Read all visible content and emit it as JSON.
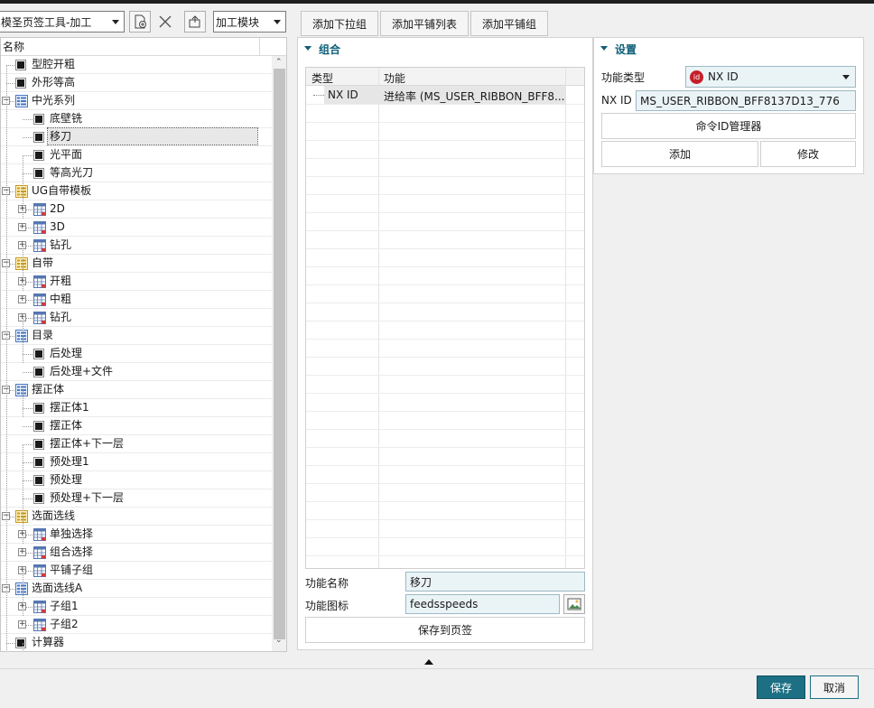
{
  "toolbar": {
    "tool_select": "模圣页签工具-加工",
    "module_select": "加工模块"
  },
  "tree": {
    "header": "名称",
    "rows": [
      {
        "label": "型腔开粗",
        "level": 0,
        "type": "item"
      },
      {
        "label": "外形等高",
        "level": 0,
        "type": "item"
      },
      {
        "label": "中光系列",
        "level": 0,
        "type": "list"
      },
      {
        "label": "底壁铣",
        "level": 1,
        "type": "item"
      },
      {
        "label": "移刀",
        "level": 1,
        "type": "item",
        "selected": true
      },
      {
        "label": "光平面",
        "level": 1,
        "type": "item"
      },
      {
        "label": "等高光刀",
        "level": 1,
        "type": "item"
      },
      {
        "label": "UG自带模板",
        "level": 0,
        "type": "group"
      },
      {
        "label": "2D",
        "level": 1,
        "type": "table"
      },
      {
        "label": "3D",
        "level": 1,
        "type": "table"
      },
      {
        "label": "钻孔",
        "level": 1,
        "type": "table"
      },
      {
        "label": "自带",
        "level": 0,
        "type": "group"
      },
      {
        "label": "开粗",
        "level": 1,
        "type": "table"
      },
      {
        "label": "中粗",
        "level": 1,
        "type": "table"
      },
      {
        "label": "钻孔",
        "level": 1,
        "type": "table"
      },
      {
        "label": "目录",
        "level": 0,
        "type": "list"
      },
      {
        "label": "后处理",
        "level": 1,
        "type": "item"
      },
      {
        "label": "后处理+文件",
        "level": 1,
        "type": "item"
      },
      {
        "label": "摆正体",
        "level": 0,
        "type": "list"
      },
      {
        "label": "摆正体1",
        "level": 1,
        "type": "item"
      },
      {
        "label": "摆正体",
        "level": 1,
        "type": "item"
      },
      {
        "label": "摆正体+下一层",
        "level": 1,
        "type": "item"
      },
      {
        "label": "预处理1",
        "level": 1,
        "type": "item"
      },
      {
        "label": "预处理",
        "level": 1,
        "type": "item"
      },
      {
        "label": "预处理+下一层",
        "level": 1,
        "type": "item"
      },
      {
        "label": "选面选线",
        "level": 0,
        "type": "group"
      },
      {
        "label": "单独选择",
        "level": 1,
        "type": "table"
      },
      {
        "label": "组合选择",
        "level": 1,
        "type": "table"
      },
      {
        "label": "平铺子组",
        "level": 1,
        "type": "table"
      },
      {
        "label": "选面选线A",
        "level": 0,
        "type": "list"
      },
      {
        "label": "子组1",
        "level": 1,
        "type": "table"
      },
      {
        "label": "子组2",
        "level": 1,
        "type": "table"
      },
      {
        "label": "计算器",
        "level": 0,
        "type": "item"
      }
    ]
  },
  "tabs": {
    "add_dropdown": "添加下拉组",
    "add_tile_list": "添加平铺列表",
    "add_tile_group": "添加平铺组"
  },
  "group_panel": {
    "title": "组合",
    "col_type": "类型",
    "col_function": "功能",
    "row_type": "NX ID",
    "row_function": "进给率 (MS_USER_RIBBON_BFF8...",
    "name_label": "功能名称",
    "name_value": "移刀",
    "icon_label": "功能图标",
    "icon_value": "feedsspeeds",
    "save_button": "保存到页签"
  },
  "settings_panel": {
    "title": "设置",
    "type_label": "功能类型",
    "type_value": "NX ID",
    "nxid_label": "NX ID",
    "nxid_value": "MS_USER_RIBBON_BFF8137D13_776",
    "cmd_manager": "命令ID管理器",
    "add": "添加",
    "modify": "修改"
  },
  "footer": {
    "save": "保存",
    "cancel": "取消"
  },
  "colors": {
    "accent": "#1d6f84",
    "title_text": "#0e5f78"
  }
}
